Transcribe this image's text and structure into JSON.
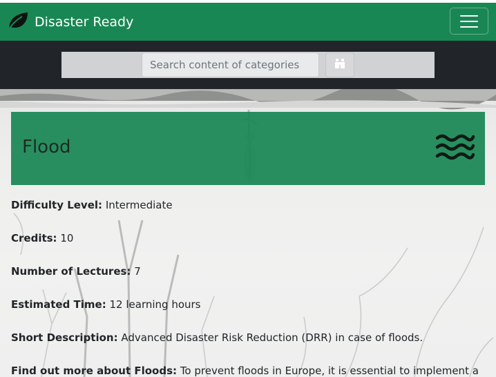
{
  "navbar": {
    "brand_icon": "leaf-icon",
    "brand_name": "Disaster Ready",
    "menu_icon": "hamburger-menu-icon",
    "color": "#198754"
  },
  "search": {
    "placeholder": "Search content of categories",
    "value": "",
    "button_icon": "binoculars-icon"
  },
  "category": {
    "title": "Flood",
    "icon": "water-waves-icon",
    "fields": [
      {
        "label": "Difficulty Level:",
        "value": "Intermediate"
      },
      {
        "label": "Credits:",
        "value": "10"
      },
      {
        "label": "Number of Lectures:",
        "value": "7"
      },
      {
        "label": "Estimated Time:",
        "value": "12 learning hours"
      },
      {
        "label": "Short Description:",
        "value": "Advanced Disaster Risk Reduction (DRR) in case of floods."
      },
      {
        "label": "Find out more about Floods:",
        "value": "To prevent floods in Europe, it is essential to implement a"
      }
    ]
  }
}
